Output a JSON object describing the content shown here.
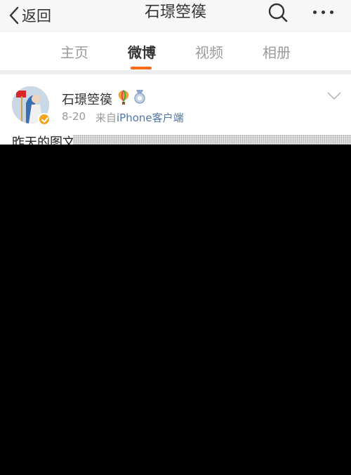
{
  "nav": {
    "back_label": "返回",
    "title": "石璟箜篌",
    "search_icon": "search-icon",
    "more_icon": "more-dots-icon"
  },
  "tabs": [
    {
      "label": "主页",
      "active": false
    },
    {
      "label": "微博",
      "active": true
    },
    {
      "label": "视频",
      "active": false
    },
    {
      "label": "相册",
      "active": false
    }
  ],
  "post": {
    "username": "石璟箜篌",
    "badges": [
      "balloon-icon",
      "medal-icon"
    ],
    "verified": true,
    "date": "8-20",
    "source_prefix": "来自",
    "source": "iPhone客户端",
    "text": "昨天的图文",
    "menu_icon": "chevron-down-icon"
  },
  "colors": {
    "accent": "#f66a1a",
    "link": "#4f76a8",
    "verify": "#f3a51c"
  }
}
